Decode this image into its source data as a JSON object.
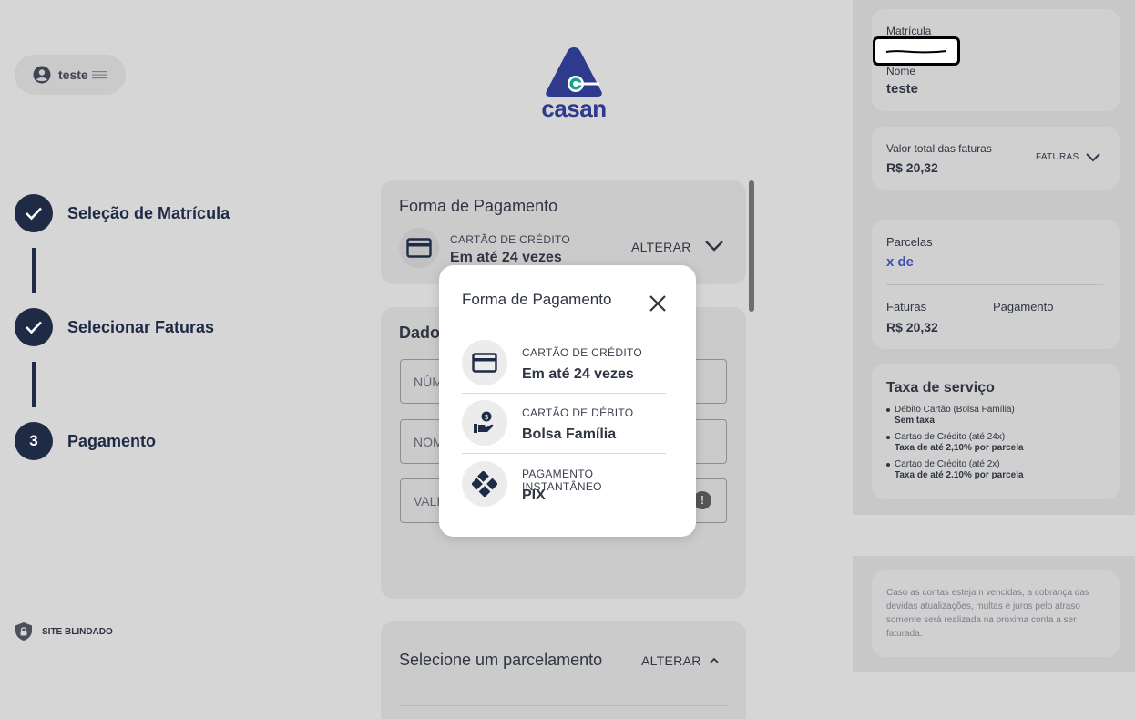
{
  "user": {
    "name": "teste"
  },
  "logo": {
    "text": "casan"
  },
  "steps": [
    {
      "label": "Seleção de Matrícula",
      "marker": "check"
    },
    {
      "label": "Selecionar Faturas",
      "marker": "check"
    },
    {
      "label": "Pagamento",
      "marker": "3"
    }
  ],
  "secure_label": "SITE BLINDADO",
  "payment_card": {
    "title": "Forma de Pagamento",
    "method_sub": "CARTÃO DE CRÉDITO",
    "method_main": "Em até 24 vezes",
    "alter_label": "ALTERAR"
  },
  "dados_card": {
    "title": "Dado",
    "fields": [
      "NÚM",
      "NOM",
      "VALI"
    ]
  },
  "installments_card": {
    "title": "Selecione um parcelamento",
    "alter_label": "ALTERAR"
  },
  "right": {
    "matricula_label": "Matrícula",
    "nome_label": "Nome",
    "nome_value": "teste",
    "total_label": "Valor total das faturas",
    "total_value": "R$ 20,32",
    "faturas_toggle": "FATURAS",
    "parcelas_label": "Parcelas",
    "parcelas_value": "x de",
    "faturas_label": "Faturas",
    "faturas_value": "R$ 20,32",
    "pagamento_label": "Pagamento",
    "taxa_title": "Taxa de serviço",
    "taxa_items": [
      {
        "name": "Débito Cartão (Bolsa Família)",
        "value": "Sem taxa"
      },
      {
        "name": "Cartao de Crédito (até 24x)",
        "value": "Taxa de até 2,10% por parcela"
      },
      {
        "name": "Cartao de Crédito (até 2x)",
        "value": "Taxa de até 2.10% por parcela"
      }
    ],
    "notice": "Caso as contas estejam vencidas, a cobrança das devidas atualizações, multas e juros pelo atraso somente será realizada na próxima conta a ser faturada."
  },
  "modal": {
    "title": "Forma de Pagamento",
    "options": [
      {
        "sub": "CARTÃO DE CRÉDITO",
        "main": "Em até 24 vezes",
        "icon": "credit-card-icon"
      },
      {
        "sub": "CARTÃO DE DÉBITO",
        "main": "Bolsa Família",
        "icon": "hand-coin-icon"
      },
      {
        "sub": "PAGAMENTO INSTANTÂNEO",
        "main": "PIX",
        "icon": "pix-icon"
      }
    ]
  },
  "colors": {
    "primary": "#1f2b45",
    "brand": "#2e3a8c",
    "link": "#3d4fb0",
    "background": "#d6d6d6"
  }
}
